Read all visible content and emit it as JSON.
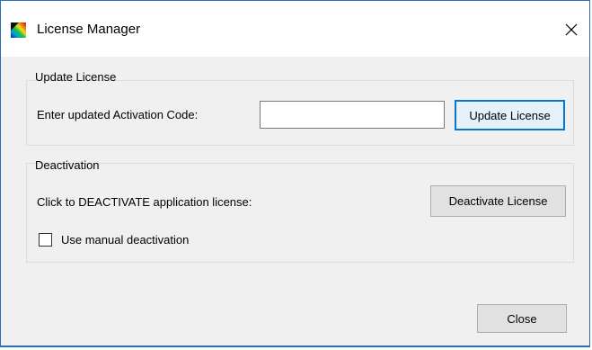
{
  "window": {
    "title": "License Manager",
    "app_icon": "rainbow-gradient-app-icon",
    "close_glyph": "✕"
  },
  "update_group": {
    "title": "Update License",
    "prompt_label": "Enter updated Activation Code:",
    "code_value": "",
    "button_label": "Update License"
  },
  "deactivation_group": {
    "title": "Deactivation",
    "prompt_label": "Click to DEACTIVATE application license:",
    "button_label": "Deactivate License",
    "checkbox_label": "Use manual deactivation",
    "checkbox_checked": false
  },
  "footer": {
    "close_label": "Close"
  },
  "colors": {
    "window_border": "#2b6fb4",
    "dialog_background": "#f0f0f0",
    "default_button_border": "#0078d7"
  }
}
